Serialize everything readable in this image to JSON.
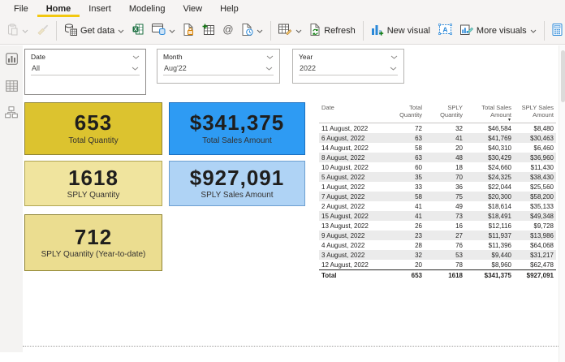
{
  "colors": {
    "accent": "#F2C811",
    "card_blue": "#2E9BF3",
    "card_gold": "#DCC32F"
  },
  "menu": {
    "items": [
      "File",
      "Home",
      "Insert",
      "Modeling",
      "View",
      "Help"
    ],
    "active": "Home"
  },
  "toolbar": {
    "get_data": "Get data",
    "refresh": "Refresh",
    "new_visual": "New visual",
    "more_visuals": "More visuals"
  },
  "slicers": [
    {
      "title": "Date",
      "value": "All"
    },
    {
      "title": "Month",
      "value": "Aug'22"
    },
    {
      "title": "Year",
      "value": "2022"
    }
  ],
  "cards": [
    {
      "value": "653",
      "label": "Total Quantity",
      "fill": "#DCC32F",
      "border": "#8F8434"
    },
    {
      "value": "$341,375",
      "label": "Total Sales Amount",
      "fill": "#2E9BF3",
      "border": "#1A6FC0"
    },
    {
      "value": "1618",
      "label": "SPLY Quantity",
      "fill": "#F0E49E",
      "border": "#B1A653"
    },
    {
      "value": "$927,091",
      "label": "SPLY Sales Amount",
      "fill": "#AFD3F5",
      "border": "#6D9FD0"
    },
    {
      "value": "712",
      "label": "SPLY Quantity (Year-to-date)",
      "fill": "#EBDD90",
      "border": "#8F8434"
    }
  ],
  "table": {
    "headers": [
      "Date",
      "Total Quantity",
      "SPLY Quantity",
      "Total Sales Amount",
      "SPLY Sales Amount"
    ],
    "sorted_column": "Total Sales Amount",
    "sort_direction": "desc",
    "rows": [
      [
        "11 August, 2022",
        "72",
        "32",
        "$46,584",
        "$8,480"
      ],
      [
        "6 August, 2022",
        "63",
        "41",
        "$41,769",
        "$30,463"
      ],
      [
        "14 August, 2022",
        "58",
        "20",
        "$40,310",
        "$6,460"
      ],
      [
        "8 August, 2022",
        "63",
        "48",
        "$30,429",
        "$36,960"
      ],
      [
        "10 August, 2022",
        "60",
        "18",
        "$24,660",
        "$11,430"
      ],
      [
        "5 August, 2022",
        "35",
        "70",
        "$24,325",
        "$38,430"
      ],
      [
        "1 August, 2022",
        "33",
        "36",
        "$22,044",
        "$25,560"
      ],
      [
        "7 August, 2022",
        "58",
        "75",
        "$20,300",
        "$58,200"
      ],
      [
        "2 August, 2022",
        "41",
        "49",
        "$18,614",
        "$35,133"
      ],
      [
        "15 August, 2022",
        "41",
        "73",
        "$18,491",
        "$49,348"
      ],
      [
        "13 August, 2022",
        "26",
        "16",
        "$12,116",
        "$9,728"
      ],
      [
        "9 August, 2022",
        "23",
        "27",
        "$11,937",
        "$13,986"
      ],
      [
        "4 August, 2022",
        "28",
        "76",
        "$11,396",
        "$64,068"
      ],
      [
        "3 August, 2022",
        "32",
        "53",
        "$9,440",
        "$31,217"
      ],
      [
        "12 August, 2022",
        "20",
        "78",
        "$8,960",
        "$62,478"
      ]
    ],
    "total": [
      "Total",
      "653",
      "1618",
      "$341,375",
      "$927,091"
    ]
  }
}
